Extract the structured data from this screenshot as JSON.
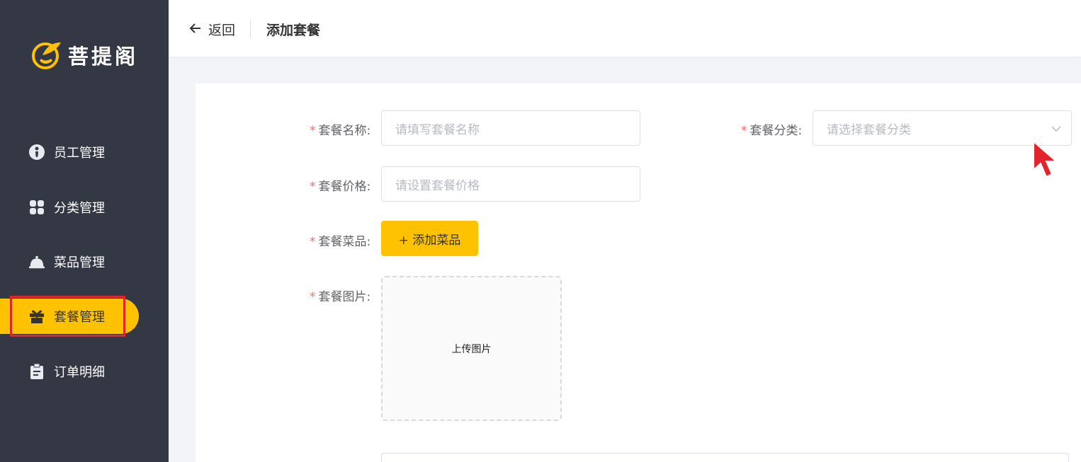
{
  "app": {
    "name": "菩提阁"
  },
  "sidebar": {
    "items": [
      {
        "label": "员工管理",
        "icon": "employee-icon"
      },
      {
        "label": "分类管理",
        "icon": "category-icon"
      },
      {
        "label": "菜品管理",
        "icon": "dish-icon"
      },
      {
        "label": "套餐管理",
        "icon": "gift-icon",
        "active": true
      },
      {
        "label": "订单明细",
        "icon": "clipboard-icon"
      }
    ]
  },
  "header": {
    "back_label": "返回",
    "title": "添加套餐"
  },
  "form": {
    "name": {
      "label": "套餐名称:",
      "placeholder": "请填写套餐名称"
    },
    "category": {
      "label": "套餐分类:",
      "placeholder": "请选择套餐分类"
    },
    "price": {
      "label": "套餐价格:",
      "placeholder": "请设置套餐价格"
    },
    "dishes": {
      "label": "套餐菜品:",
      "button": "+ 添加菜品"
    },
    "image": {
      "label": "套餐图片:",
      "upload_text": "上传图片"
    }
  },
  "colors": {
    "sidebar_bg": "#343744",
    "accent": "#ffc200",
    "required_star": "#f56c6c",
    "highlight": "#e3242b"
  }
}
